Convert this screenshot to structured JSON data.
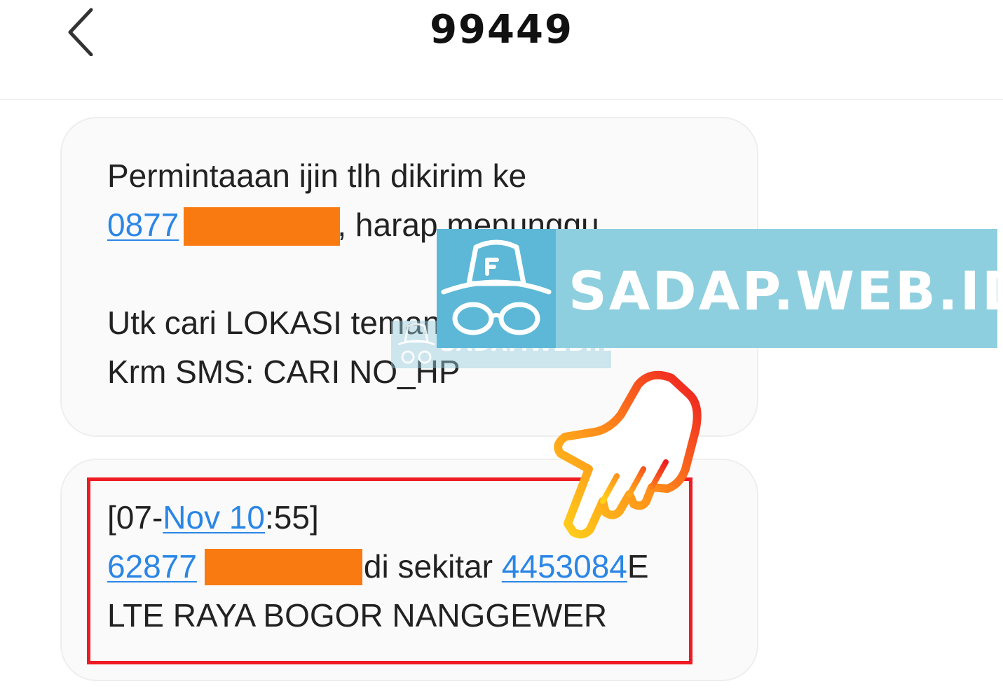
{
  "header": {
    "title": "99449",
    "back_icon": "chevron-left-icon"
  },
  "messages": [
    {
      "line1": "Permintaaan ijin tlh dikirim ke",
      "line2_link": "0877",
      "line2_tail": ", harap menunggu",
      "line3": "Utk cari LOKASI teman",
      "line4": "Krm SMS: CARI NO_HP"
    },
    {
      "date_open": "[07-",
      "date_link": "Nov 10",
      "date_close": ":55]",
      "phone_link": "62877",
      "location_mid": "di sekitar ",
      "code_link": "4453084",
      "code_tail": "E",
      "line3": "LTE RAYA BOGOR NANGGEWER"
    }
  ],
  "watermark": {
    "text": "SADAP.WEB.ID",
    "small_text": "SADAP.WEB.ID",
    "icon": "spy-hat-glasses-icon",
    "color": "#8ecfdf"
  },
  "colors": {
    "link": "#2a86e6",
    "redaction": "#f87a11",
    "highlight": "#ee1c22"
  },
  "pointer_icon": "pointing-hand-icon"
}
